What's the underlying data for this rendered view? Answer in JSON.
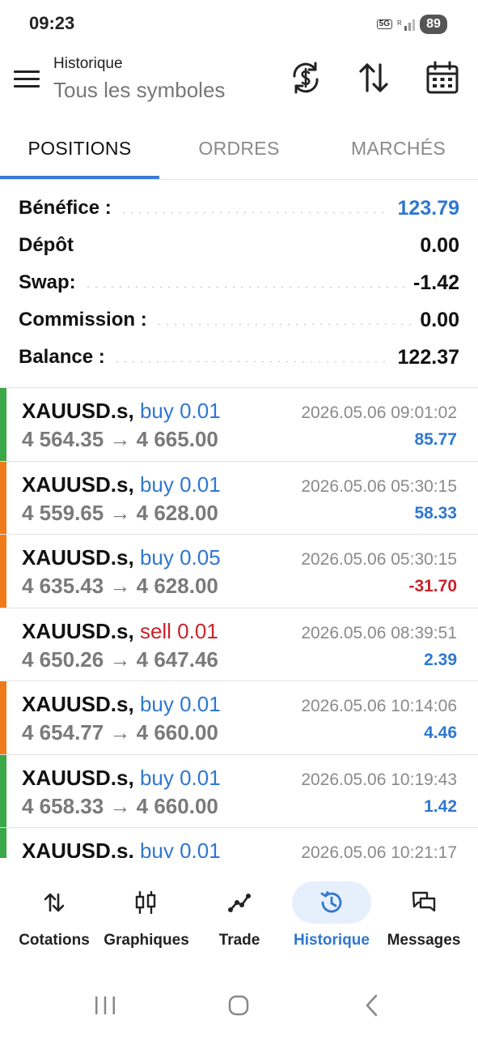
{
  "status_bar": {
    "time": "09:23",
    "network_top": "5G",
    "network_bottom": "R",
    "battery": "89"
  },
  "header": {
    "title": "Historique",
    "subtitle": "Tous les symboles",
    "icons": [
      "menu-icon",
      "currency-exchange-icon",
      "sort-icon",
      "calendar-icon"
    ]
  },
  "tabs": [
    {
      "label": "POSITIONS",
      "active": true
    },
    {
      "label": "ORDRES",
      "active": false
    },
    {
      "label": "MARCHÉS",
      "active": false
    }
  ],
  "summary": [
    {
      "label": "Bénéfice :",
      "value": "123.79",
      "color": "#2f77d0"
    },
    {
      "label": "Dépôt",
      "value": "0.00",
      "color": "#111111"
    },
    {
      "label": "Swap:",
      "value": "-1.42",
      "color": "#111111"
    },
    {
      "label": "Commission :",
      "value": "0.00",
      "color": "#111111"
    },
    {
      "label": "Balance :",
      "value": "122.37",
      "color": "#111111"
    }
  ],
  "trades": [
    {
      "symbol": "XAUUSD.s,",
      "direction": "buy 0.01",
      "side": "buy",
      "prices": "4 564.35 → 4 665.00",
      "time": "2026.05.06 09:01:02",
      "profit": "85.77",
      "bar_color": "#3aa847"
    },
    {
      "symbol": "XAUUSD.s,",
      "direction": "buy 0.01",
      "side": "buy",
      "prices": "4 559.65 → 4 628.00",
      "time": "2026.05.06 05:30:15",
      "profit": "58.33",
      "bar_color": "#ef7a1a"
    },
    {
      "symbol": "XAUUSD.s,",
      "direction": "buy 0.05",
      "side": "buy",
      "prices": "4 635.43 → 4 628.00",
      "time": "2026.05.06 05:30:15",
      "profit": "-31.70",
      "bar_color": "#ef7a1a"
    },
    {
      "symbol": "XAUUSD.s,",
      "direction": "sell 0.01",
      "side": "sell",
      "prices": "4 650.26 → 4 647.46",
      "time": "2026.05.06 08:39:51",
      "profit": "2.39",
      "bar_color": ""
    },
    {
      "symbol": "XAUUSD.s,",
      "direction": "buy 0.01",
      "side": "buy",
      "prices": "4 654.77 → 4 660.00",
      "time": "2026.05.06 10:14:06",
      "profit": "4.46",
      "bar_color": "#ef7a1a"
    },
    {
      "symbol": "XAUUSD.s,",
      "direction": "buy 0.01",
      "side": "buy",
      "prices": "4 658.33 → 4 660.00",
      "time": "2026.05.06 10:19:43",
      "profit": "1.42",
      "bar_color": "#3aa847"
    },
    {
      "symbol": "XAUUSD.s,",
      "direction": "buy 0.01",
      "side": "buy",
      "prices": "",
      "time": "2026.05.06 10:21:17",
      "profit": "",
      "bar_color": "#3aa847"
    }
  ],
  "bottom_nav": [
    {
      "label": "Cotations",
      "icon": "quotes-arrows-icon",
      "active": false
    },
    {
      "label": "Graphiques",
      "icon": "candlestick-chart-icon",
      "active": false
    },
    {
      "label": "Trade",
      "icon": "trade-trend-icon",
      "active": false
    },
    {
      "label": "Historique",
      "icon": "history-icon",
      "active": true
    },
    {
      "label": "Messages",
      "icon": "messages-icon",
      "active": false
    }
  ],
  "colors": {
    "accent": "#2f77d0",
    "negative": "#c8232c",
    "profit_bar": "#3aa847",
    "loss_bar": "#ef7a1a",
    "active_nav_bg": "#e6f0fc"
  }
}
